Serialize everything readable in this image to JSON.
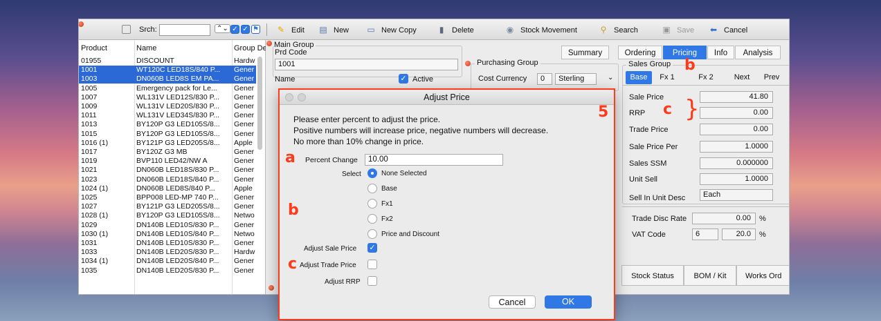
{
  "toolbar": {
    "srch_label": "Srch:",
    "stepper": "⌃⌄",
    "items": [
      {
        "label": "Edit",
        "icon": "pencil-icon"
      },
      {
        "label": "New",
        "icon": "document-icon"
      },
      {
        "label": "New Copy",
        "icon": "copy-icon"
      },
      {
        "label": "Delete",
        "icon": "trash-icon"
      },
      {
        "label": "Stock Movement",
        "icon": "stock-icon"
      },
      {
        "label": "Search",
        "icon": "search-icon"
      },
      {
        "label": "Save",
        "icon": "save-icon"
      },
      {
        "label": "Cancel",
        "icon": "back-arrow-icon"
      }
    ]
  },
  "products": {
    "headers": [
      "Product",
      "Name",
      "Group De"
    ],
    "rows": [
      [
        "01955",
        "DISCOUNT",
        "Hardw"
      ],
      [
        "1001",
        "WT120C LED18S/840 P...",
        "Gener"
      ],
      [
        "1003",
        "DN060B LED8S EM PA...",
        "Gener"
      ],
      [
        "1005",
        "Emergency pack for Le...",
        "Gener"
      ],
      [
        "1007",
        "WL131V LED12S/830 P...",
        "Gener"
      ],
      [
        "1009",
        "WL131V LED20S/830 P...",
        "Gener"
      ],
      [
        "1011",
        "WL131V LED34S/830 P...",
        "Gener"
      ],
      [
        "1013",
        "BY120P G3 LED105S/8...",
        "Gener"
      ],
      [
        "1015",
        "BY120P G3 LED105S/8...",
        "Gener"
      ],
      [
        "1016 (1)",
        "BY121P G3 LED205S/8...",
        "Apple"
      ],
      [
        "1017",
        "BY120Z G3 MB",
        "Gener"
      ],
      [
        "1019",
        "BVP110 LED42/NW A",
        "Gener"
      ],
      [
        "1021",
        "DN060B LED18S/830 P...",
        "Gener"
      ],
      [
        "1023",
        "DN060B LED18S/840 P...",
        "Gener"
      ],
      [
        "1024 (1)",
        "DN060B LED8S/840 P...",
        "Apple"
      ],
      [
        "1025",
        "BPP008 LED-MP 740 P...",
        "Gener"
      ],
      [
        "1027",
        "BY121P G3 LED205S/8...",
        "Gener"
      ],
      [
        "1028 (1)",
        "BY120P G3 LED105S/8...",
        "Netwo"
      ],
      [
        "1029",
        "DN140B LED10S/830 P...",
        "Gener"
      ],
      [
        "1030 (1)",
        "DN140B LED10S/840 P...",
        "Netwo"
      ],
      [
        "1031",
        "DN140B LED10S/830 P...",
        "Gener"
      ],
      [
        "1033",
        "DN140B LED20S/830 P...",
        "Hardw"
      ],
      [
        "1034 (1)",
        "DN140B LED20S/840 P...",
        "Gener"
      ],
      [
        "1035",
        "DN140B LED20S/830 P...",
        "Gener"
      ]
    ]
  },
  "main_group": {
    "legend": "Main Group",
    "prd_code_label": "Prd Code",
    "prd_code": "1001",
    "name_label": "Name",
    "active_label": "Active"
  },
  "purchasing": {
    "legend": "Purchasing Group",
    "cost_currency_label": "Cost Currency",
    "cost_currency_num": "0",
    "currency": "Sterling"
  },
  "tabs": [
    "Summary",
    "Ordering",
    "Pricing",
    "Info",
    "Analysis"
  ],
  "sales_group": {
    "legend": "Sales Group",
    "subtabs": [
      "Base",
      "Fx 1",
      "Fx 2",
      "Next",
      "Prev"
    ],
    "fields": [
      {
        "label": "Sale Price",
        "value": "41.80"
      },
      {
        "label": "RRP",
        "value": "0.00"
      },
      {
        "label": "Trade Price",
        "value": "0.00"
      },
      {
        "label": "Sale Price Per",
        "value": "1.0000"
      },
      {
        "label": "Sales SSM",
        "value": "0.000000"
      },
      {
        "label": "Unit Sell",
        "value": "1.0000"
      }
    ],
    "sell_in_unit_label": "Sell In Unit Desc",
    "sell_in_unit_value": "Each",
    "trade_disc_label": "Trade Disc Rate",
    "trade_disc_value": "0.00",
    "vat_label": "VAT Code",
    "vat_code": "6",
    "vat_rate": "20.0",
    "percent": "%"
  },
  "bottom_tabs": [
    "Stock Status",
    "BOM / Kit",
    "Works Ord"
  ],
  "dialog": {
    "title": "Adjust Price",
    "messages": [
      "Please enter percent to adjust the price.",
      "Positive numbers will increase price, negative numbers will decrease.",
      "No more than 10% change in price."
    ],
    "percent_label": "Percent Change",
    "percent_value": "10.00",
    "select_label": "Select",
    "options": [
      "None Selected",
      "Base",
      "Fx1",
      "Fx2",
      "Price and Discount"
    ],
    "selected_option": "None Selected",
    "adjust_sale_label": "Adjust Sale Price",
    "adjust_sale_checked": true,
    "adjust_trade_label": "Adjust Trade Price",
    "adjust_trade_checked": false,
    "adjust_rrp_label": "Adjust RRP",
    "adjust_rrp_checked": false,
    "cancel_label": "Cancel",
    "ok_label": "OK"
  },
  "annotations": {
    "five": "5",
    "a": "a",
    "b": "b",
    "c": "c",
    "brace": "}"
  },
  "colors": {
    "accent": "#2f78e6",
    "annotation": "#ff3a1a"
  }
}
